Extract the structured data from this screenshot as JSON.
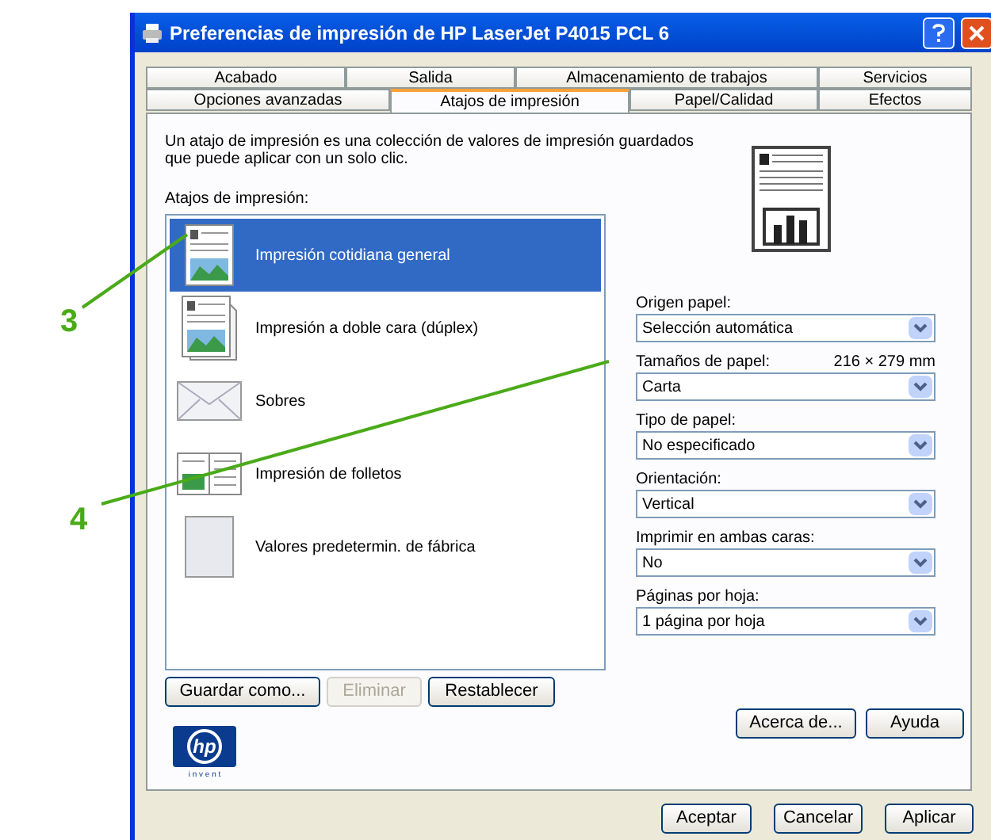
{
  "window": {
    "title": "Preferencias de impresión de HP LaserJet P4015 PCL 6"
  },
  "tab_rows": [
    [
      {
        "label": "Acabado",
        "selected": false
      },
      {
        "label": "Salida",
        "selected": false
      },
      {
        "label": "Almacenamiento de trabajos",
        "selected": false
      },
      {
        "label": "Servicios",
        "selected": false
      }
    ],
    [
      {
        "label": "Opciones avanzadas",
        "selected": false
      },
      {
        "label": "Atajos de impresión",
        "selected": true
      },
      {
        "label": "Papel/Calidad",
        "selected": false
      },
      {
        "label": "Efectos",
        "selected": false
      }
    ]
  ],
  "description": "Un atajo de impresión es una colección de valores de impresión guardados que puede aplicar con un solo clic.",
  "shortcuts": {
    "label": "Atajos de impresión:",
    "items": [
      {
        "kind": "standard",
        "label": "Impresión cotidiana general",
        "selected": true
      },
      {
        "kind": "duplex",
        "label": "Impresión a doble cara (dúplex)",
        "selected": false
      },
      {
        "kind": "envelope",
        "label": "Sobres",
        "selected": false
      },
      {
        "kind": "booklet",
        "label": "Impresión de folletos",
        "selected": false
      },
      {
        "kind": "blank",
        "label": "Valores predetermin. de fábrica",
        "selected": false
      }
    ]
  },
  "list_buttons": [
    {
      "label": "Guardar como...",
      "disabled": false
    },
    {
      "label": "Eliminar",
      "disabled": true
    },
    {
      "label": "Restablecer",
      "disabled": false
    }
  ],
  "settings": [
    {
      "label": "Origen papel:",
      "value": "Selección automática"
    },
    {
      "label": "Tamaños de papel:",
      "note": "216 × 279 mm",
      "value": "Carta"
    },
    {
      "label": "Tipo de papel:",
      "value": "No especificado"
    },
    {
      "label": "Orientación:",
      "value": "Vertical"
    },
    {
      "label": "Imprimir en ambas caras:",
      "value": "No"
    },
    {
      "label": "Páginas por hoja:",
      "value": "1 página por hoja"
    }
  ],
  "logo": {
    "mark": "hp",
    "tagline": "i n v e n t"
  },
  "panel_buttons": [
    "Acerca de...",
    "Ayuda"
  ],
  "dialog_buttons": [
    "Aceptar",
    "Cancelar",
    "Aplicar"
  ],
  "callouts": [
    {
      "label": "3"
    },
    {
      "label": "4"
    }
  ]
}
